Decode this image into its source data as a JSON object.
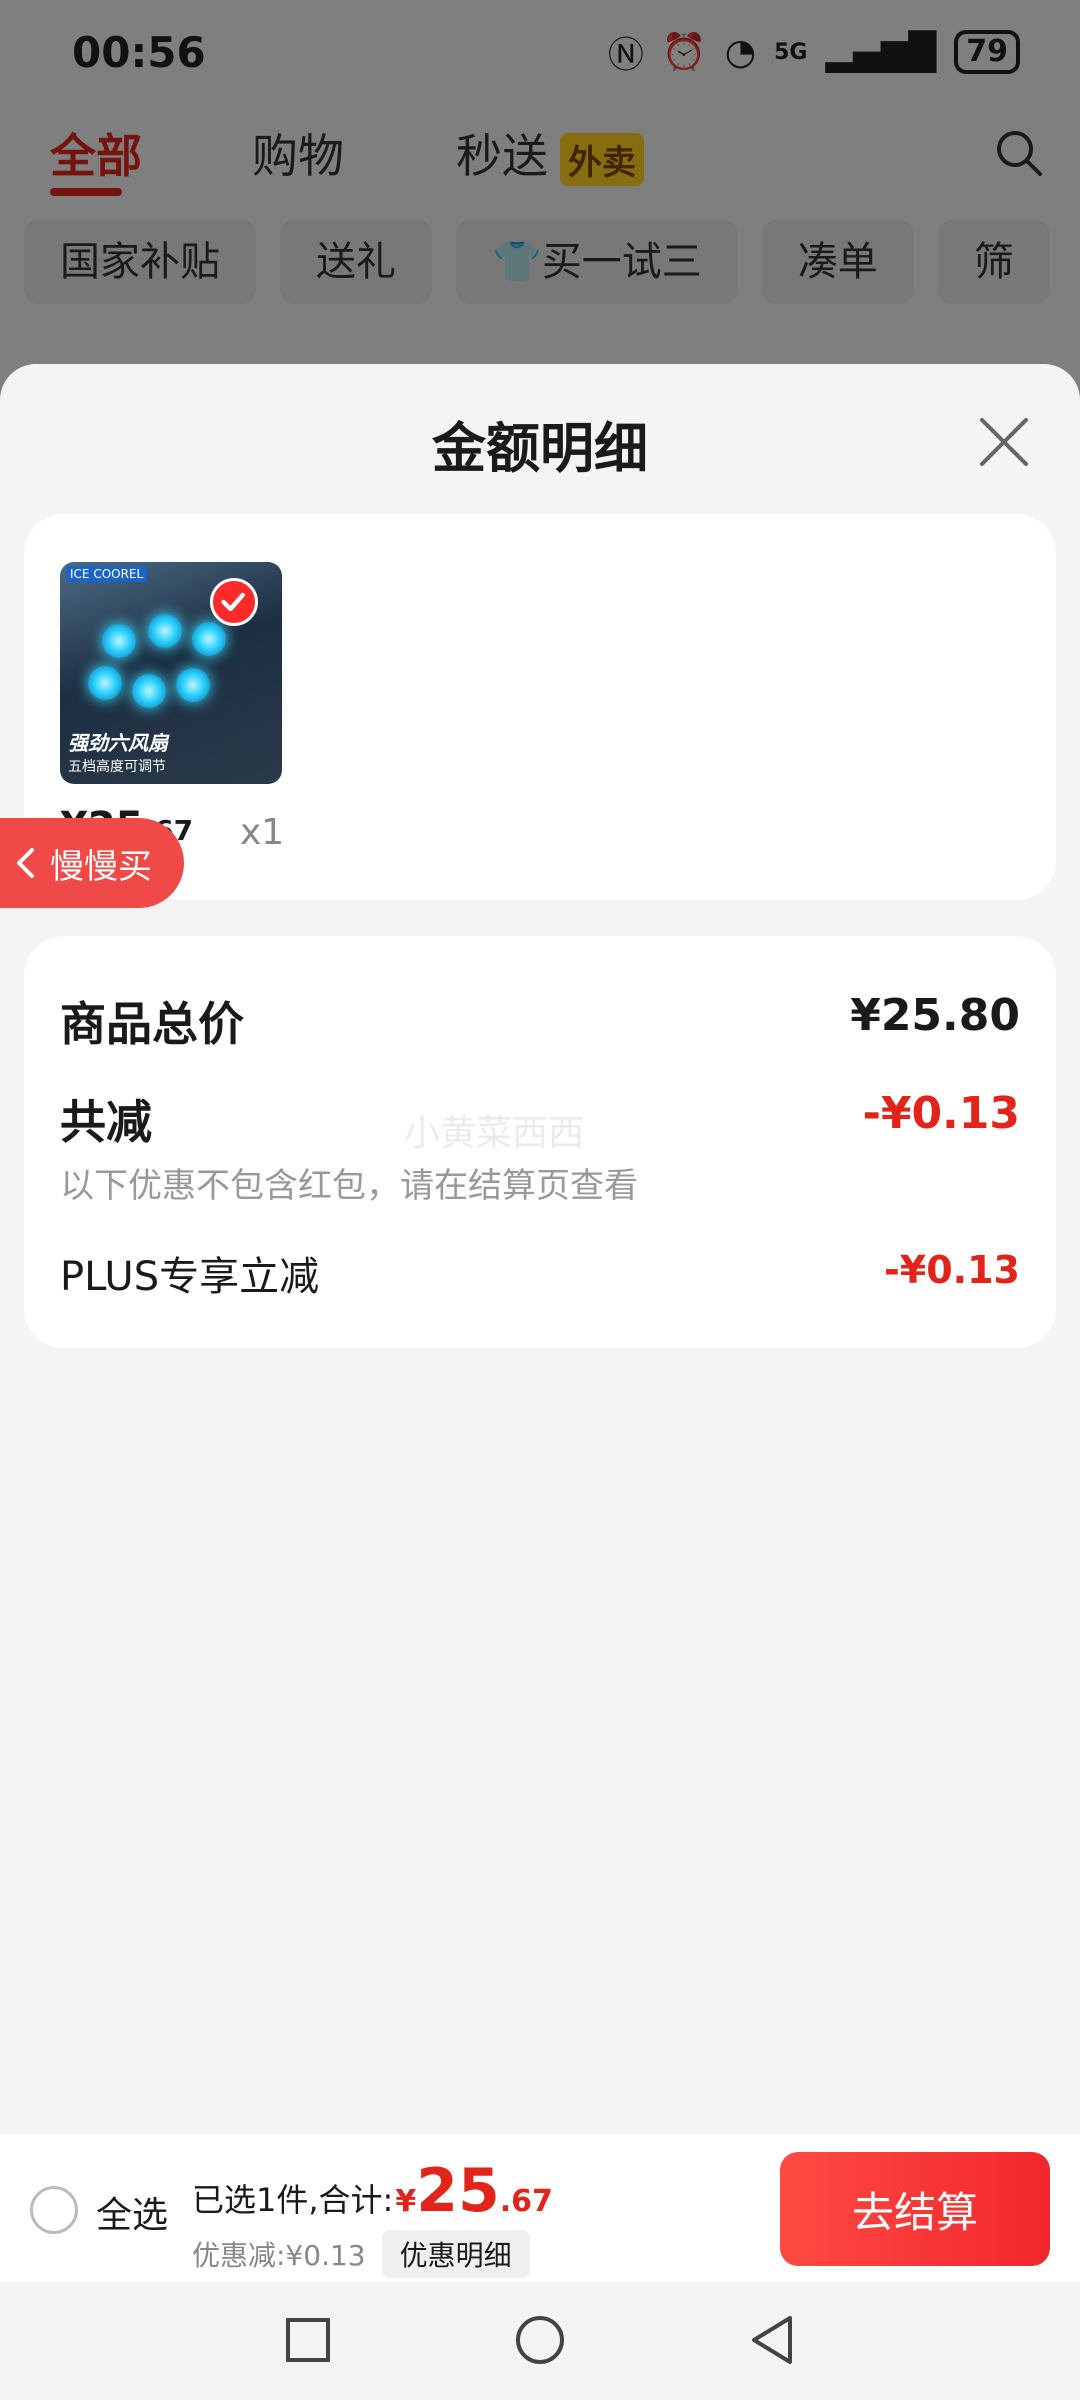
{
  "status_bar": {
    "time": "00:56",
    "signal_label": "5G",
    "battery": "79"
  },
  "top_tabs": {
    "all": "全部",
    "shopping": "购物",
    "express": "秒送",
    "waimai_badge": "外卖"
  },
  "chips": [
    "国家补贴",
    "送礼",
    "买一试三",
    "凑单",
    "筛"
  ],
  "sheet": {
    "title": "金额明细"
  },
  "product": {
    "price_int": "¥25",
    "price_dec": ".67",
    "quantity": "x1",
    "image_brand": "ICE COOREL",
    "image_text_main": "强劲六风扇",
    "image_text_sub": "五档高度可调节"
  },
  "slow_buy": {
    "label": "慢慢买"
  },
  "details": {
    "total_label": "商品总价",
    "total_value": "¥25.80",
    "reduction_label": "共减",
    "reduction_value": "-¥0.13",
    "reduction_note": "以下优惠不包含红包，请在结算页查看",
    "plus_label": "PLUS专享立减",
    "plus_value": "-¥0.13",
    "watermark": "小黄菜西西"
  },
  "bottom_bar": {
    "select_all": "全选",
    "selected_text": "已选1件,合计:",
    "total_yen": "¥",
    "total_int": "25",
    "total_dec": ".67",
    "discount_text": "优惠减:¥0.13",
    "discount_detail": "优惠明细",
    "checkout": "去结算"
  },
  "colors": {
    "accent_red": "#e1251b",
    "badge_yellow": "#ffd21f"
  }
}
